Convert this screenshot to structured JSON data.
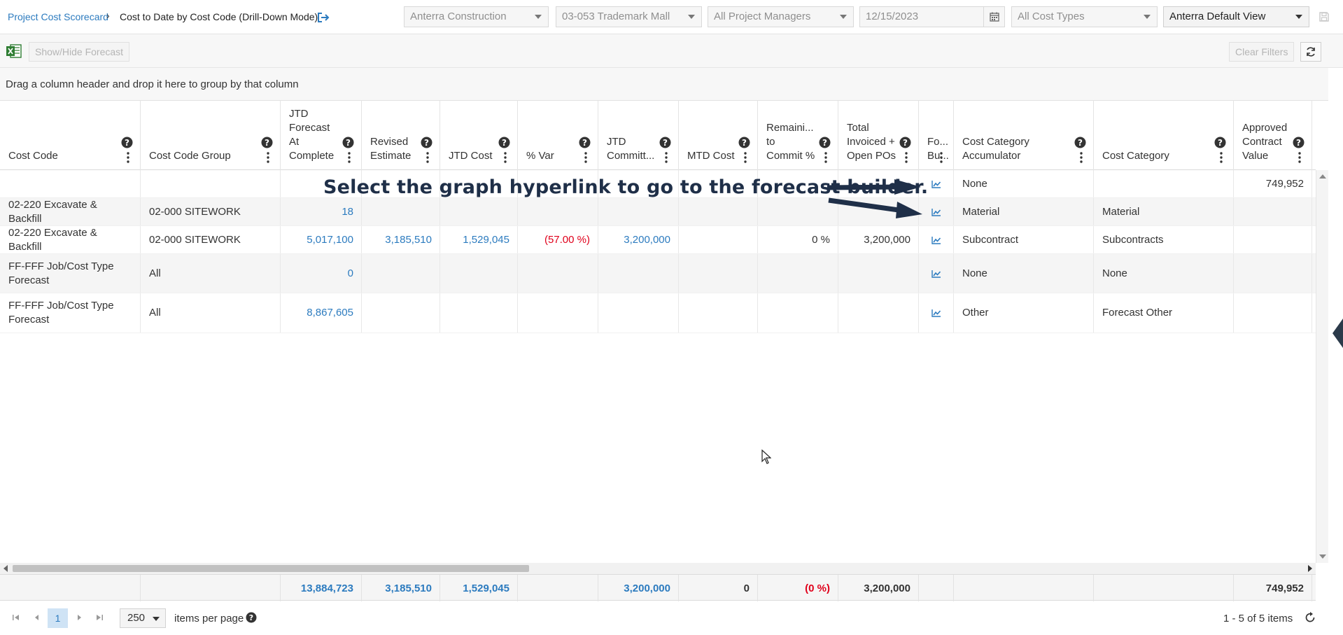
{
  "breadcrumb": {
    "parent": "Project Cost Scorecard",
    "separator": "›",
    "current": "Cost to Date by Cost Code  (Drill-Down Mode)"
  },
  "filters": {
    "company": "Anterra Construction",
    "project": "03-053 Trademark Mall",
    "managers": "All Project Managers",
    "date": "12/15/2023",
    "cost_types": "All Cost Types",
    "view": "Anterra Default View"
  },
  "toolbar": {
    "show_hide_forecast": "Show/Hide Forecast",
    "clear_filters": "Clear Filters"
  },
  "group_panel": "Drag a column header and drop it here to group by that column",
  "columns": [
    "Cost Code",
    "Cost Code Group",
    "JTD\nForecast\nAt\nComplete",
    "Revised\nEstimate",
    "JTD Cost",
    "% Var",
    "JTD\nCommitt...",
    "MTD Cost",
    "Remaini...\nto\nCommit %",
    "Total\nInvoiced +\nOpen POs",
    "Fo...\nBu...",
    "Cost Category\nAccumulator",
    "Cost Category",
    "Approved\nContract\nValue"
  ],
  "rows": [
    [
      "",
      "",
      "",
      "",
      "",
      "",
      "",
      "",
      "",
      "",
      "",
      "None",
      "",
      "749,952"
    ],
    [
      "02-220 Excavate & Backfill",
      "02-000 SITEWORK",
      "18",
      "",
      "",
      "",
      "",
      "",
      "",
      "",
      "",
      "Material",
      "Material",
      ""
    ],
    [
      "02-220 Excavate & Backfill",
      "02-000 SITEWORK",
      "5,017,100",
      "3,185,510",
      "1,529,045",
      "(57.00 %)",
      "3,200,000",
      "",
      "0 %",
      "3,200,000",
      "",
      "Subcontract",
      "Subcontracts",
      ""
    ],
    [
      "FF-FFF Job/Cost Type Forecast",
      "All",
      "0",
      "",
      "",
      "",
      "",
      "",
      "",
      "",
      "",
      "None",
      "None",
      ""
    ],
    [
      "FF-FFF Job/Cost Type Forecast",
      "All",
      "8,867,605",
      "",
      "",
      "",
      "",
      "",
      "",
      "",
      "",
      "Other",
      "Forecast Other",
      ""
    ]
  ],
  "totals": [
    "",
    "",
    "13,884,723",
    "3,185,510",
    "1,529,045",
    "",
    "3,200,000",
    "0",
    "(0 %)",
    "3,200,000",
    "",
    "",
    "",
    "749,952"
  ],
  "annotation": "Select the graph hyperlink to go to the forecast builder.",
  "pager": {
    "page": "1",
    "page_size": "250",
    "items_per_page": "items per page",
    "info": "1 - 5 of 5 items"
  },
  "colors": {
    "link": "#2c7bbf",
    "negative": "#e0001b",
    "annotation": "#1f2f48"
  }
}
